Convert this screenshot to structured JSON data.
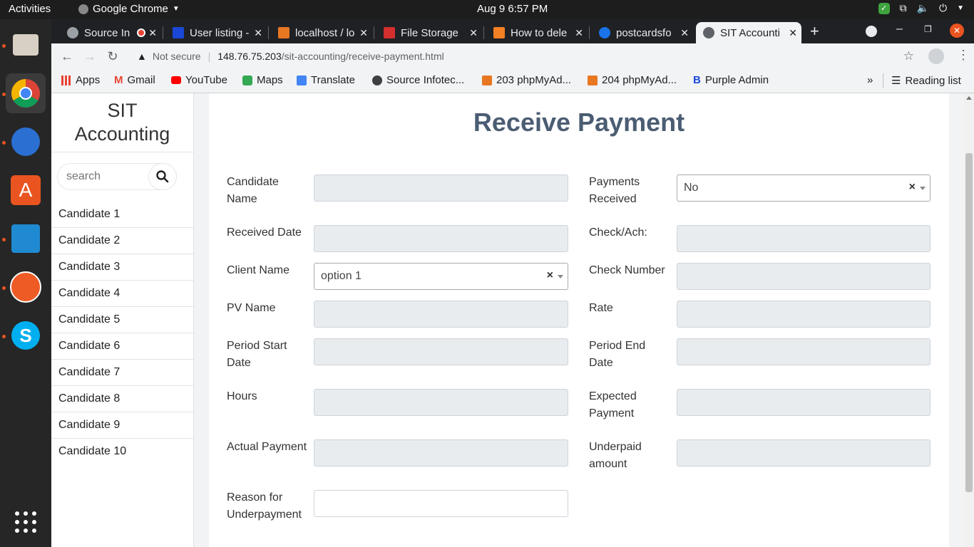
{
  "system": {
    "activities": "Activities",
    "app_name": "Google Chrome",
    "clock": "Aug 9   6:57 PM"
  },
  "tabs": [
    {
      "title": "Source In",
      "fav_color": "#9aa0a6"
    },
    {
      "title": "User listing -",
      "fav_color": "#1a47d6"
    },
    {
      "title": "localhost / lo",
      "fav_color": "#e87722"
    },
    {
      "title": "File Storage",
      "fav_color": "#d32f2f"
    },
    {
      "title": "How to dele",
      "fav_color": "#f48024"
    },
    {
      "title": "postcardsfo",
      "fav_color": "#1a73e8"
    },
    {
      "title": "SIT Accounti",
      "fav_color": "#9aa0a6"
    }
  ],
  "omnibox": {
    "security": "Not secure",
    "url_host": "148.76.75.203",
    "url_path": "/sit-accounting/receive-payment.html"
  },
  "bookmarks": [
    {
      "label": "Apps",
      "icon": "apps-grid-icon"
    },
    {
      "label": "Gmail",
      "icon": "gmail-icon"
    },
    {
      "label": "YouTube",
      "icon": "youtube-icon"
    },
    {
      "label": "Maps",
      "icon": "maps-icon"
    },
    {
      "label": "Translate",
      "icon": "translate-icon"
    },
    {
      "label": "Source Infotec...",
      "icon": "globe-icon"
    },
    {
      "label": "203 phpMyAd...",
      "icon": "phpmyadmin-icon"
    },
    {
      "label": "204 phpMyAd...",
      "icon": "phpmyadmin-icon"
    },
    {
      "label": "Purple Admin",
      "icon": "bootstrap-icon"
    }
  ],
  "reading_list": "Reading list",
  "sidebar": {
    "brand_line1": "SIT",
    "brand_line2": "Accounting",
    "search_placeholder": "search",
    "candidates": [
      "Candidate 1",
      "Candidate 2",
      "Candidate 3",
      "Candidate 4",
      "Candidate 5",
      "Candidate 6",
      "Candidate 7",
      "Candidate 8",
      "Candidate 9",
      "Candidate 10"
    ]
  },
  "form": {
    "title": "Receive Payment",
    "candidate_name": {
      "line1": "Candidate",
      "line2": "Name"
    },
    "payments_received": {
      "line1": "Payments",
      "line2": "Received",
      "value": "No"
    },
    "received_date": "Received Date",
    "check_ach": "Check/Ach:",
    "client_name": {
      "label": "Client Name",
      "value": "option 1"
    },
    "check_number": "Check Number",
    "pv_name": "PV Name",
    "rate": "Rate",
    "period_start": {
      "line1": "Period Start",
      "line2": "Date"
    },
    "period_end": {
      "line1": "Period End",
      "line2": "Date"
    },
    "hours": "Hours",
    "expected_payment": {
      "line1": "Expected",
      "line2": "Payment"
    },
    "actual_payment": "Actual Payment",
    "underpaid_amount": {
      "line1": "Underpaid",
      "line2": "amount"
    },
    "reason_underpayment": {
      "line1": "Reason for",
      "line2": "Underpayment"
    }
  }
}
